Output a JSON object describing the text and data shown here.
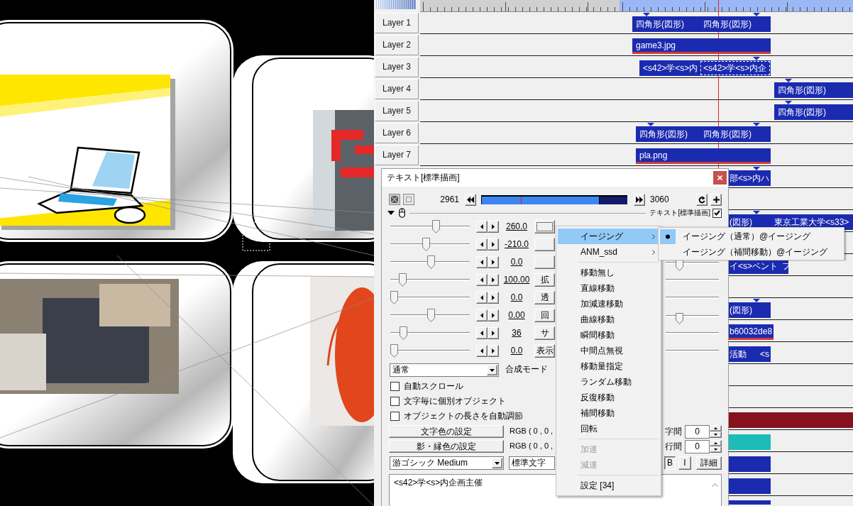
{
  "timeline": {
    "ruler": {
      "level": 0.54
    },
    "layers": [
      {
        "label": "Layer 1",
        "clips": [
          {
            "text": "四角形(図形)",
            "kind": "shape",
            "color": "#1b2bb0",
            "marker": true,
            "selected": false
          },
          {
            "text": "四角形(図形)",
            "kind": "shape",
            "color": "#1b2bb0",
            "marker": true,
            "selected": false
          }
        ]
      },
      {
        "label": "Layer 2",
        "clips": [
          {
            "text": "game3.jpg",
            "kind": "image",
            "color": "#1b2bb0",
            "marker": false,
            "selected": false
          }
        ]
      },
      {
        "label": "Layer 3",
        "clips": [
          {
            "text": "<s42>学<s>内",
            "kind": "text",
            "color": "#1b2bb0",
            "marker": false,
            "selected": false
          },
          {
            "text": "<s42>学<s>内企",
            "kind": "text",
            "color": "#1b2bb0",
            "marker": true,
            "selected": true
          }
        ]
      },
      {
        "label": "Layer 4",
        "clips": [
          {
            "text": "四角形(図形)",
            "kind": "shape",
            "color": "#1b2bb0",
            "marker": true,
            "selected": false
          }
        ]
      },
      {
        "label": "Layer 5",
        "clips": [
          {
            "text": "四角形(図形)",
            "kind": "shape",
            "color": "#1b2bb0",
            "marker": true,
            "selected": false
          }
        ]
      },
      {
        "label": "Layer 6",
        "clips": [
          {
            "text": "四角形(図形)",
            "kind": "shape",
            "color": "#1b2bb0",
            "marker": true,
            "selected": false
          },
          {
            "text": "四角形(図形)",
            "kind": "shape",
            "color": "#1b2bb0",
            "marker": true,
            "selected": false
          }
        ]
      },
      {
        "label": "Layer 7",
        "clips": [
          {
            "text": "pla.png",
            "kind": "image",
            "color": "#1b2bb0",
            "marker": false,
            "selected": false
          }
        ]
      },
      {
        "clips": [
          {
            "text": "部<s>内ハ",
            "kind": "text",
            "color": "#1b2bb0",
            "marker": true,
            "selected": false
          }
        ]
      },
      {
        "clips": [
          {
            "text": "(図形)",
            "kind": "shape",
            "color": "#1b2bb0",
            "marker": true,
            "selected": false
          },
          {
            "text": "東京工業大学<s33>",
            "kind": "text",
            "color": "#1b2bb0",
            "marker": false,
            "selected": false
          }
        ]
      },
      {
        "clips": [
          {
            "text": "イ<s>ベント",
            "kind": "text",
            "color": "#1b2bb0",
            "marker": false,
            "selected": false
          },
          {
            "text": "フ",
            "kind": "text",
            "color": "#1b2bb0",
            "marker": false,
            "selected": false
          }
        ]
      },
      {
        "clips": [
          {
            "text": "(図形)",
            "kind": "shape",
            "color": "#1b2bb0",
            "marker": true,
            "selected": false
          }
        ]
      },
      {
        "clips": [
          {
            "text": "b60032de8",
            "kind": "image",
            "color": "#1b2bb0",
            "marker": false,
            "selected": false
          }
        ]
      },
      {
        "clips": [
          {
            "text": "活動",
            "kind": "text",
            "color": "#1b2bb0",
            "marker": false,
            "selected": false
          },
          {
            "text": "<s",
            "kind": "text",
            "color": "#1b2bb0",
            "marker": false,
            "selected": false
          }
        ]
      },
      {
        "clips": [
          {
            "kind": "filter",
            "color": "#86121d",
            "marker": false,
            "selected": false
          }
        ]
      },
      {
        "clips": [
          {
            "kind": "filter",
            "color": "#1cbdb8",
            "marker": false,
            "selected": false
          }
        ]
      },
      {
        "clips": [
          {
            "kind": "shape",
            "color": "#1b2bb0",
            "marker": false,
            "selected": false
          }
        ]
      },
      {
        "clips": [
          {
            "kind": "shape",
            "color": "#1b2bb0",
            "marker": false,
            "selected": false
          }
        ]
      },
      {
        "clips": [
          {
            "kind": "shape",
            "color": "#1b2bb0",
            "marker": false,
            "selected": false
          }
        ]
      }
    ]
  },
  "dialog": {
    "title": "テキスト[標準描画]",
    "frame_start": "2961",
    "frame_end": "3060",
    "seek_bar": {
      "level": 0.81,
      "cursor": {
        "level": 0.27
      }
    },
    "header": {
      "label": "テキスト[標準描画]",
      "checked": true
    },
    "sliders": [
      {
        "value": "260.0",
        "level": 0.58,
        "focused": true
      },
      {
        "value": "-210.0",
        "level": 0.45,
        "focused": false
      },
      {
        "value": "0.0",
        "level": 0.51,
        "focused": false,
        "end_slider": {
          "level": 0.22
        }
      },
      {
        "value": "100.00",
        "level": 0.12,
        "label": "拡",
        "focused": false
      },
      {
        "value": "0.0",
        "level": 0,
        "label": "透",
        "focused": false
      },
      {
        "value": "0.00",
        "level": 0.51,
        "label": "回",
        "focused": false,
        "end_slider": {
          "level": 0.22
        }
      },
      {
        "value": "36",
        "level": 0.13,
        "label": "サ",
        "focused": false
      },
      {
        "value": "0.0",
        "level": 0,
        "label": "表示",
        "focused": false
      }
    ],
    "blend": {
      "value": "通常",
      "label": "合成モード"
    },
    "options": [
      {
        "label": "自動スクロール",
        "checked": false
      },
      {
        "label": "文字毎に個別オブジェクト",
        "checked": false
      },
      {
        "label": "オブジェクトの長さを自動調節",
        "checked": false
      }
    ],
    "color_settings": [
      {
        "button": "文字色の設定",
        "value": "RGB ( 0 , 0 ,"
      },
      {
        "button": "影・縁色の設定",
        "value": "RGB ( 0 , 0 ,"
      }
    ],
    "spacing": [
      {
        "label": "字間",
        "value": "0"
      },
      {
        "label": "行間",
        "value": "0"
      }
    ],
    "font": "游ゴシック Medium",
    "style": "標準文字",
    "format_buttons": [
      {
        "label": "B",
        "pressed": true
      },
      {
        "label": "I",
        "pressed": false
      },
      {
        "label": "詳細",
        "pressed": false
      }
    ],
    "text": "<s42>学<s>内企画主催"
  },
  "context_menu": {
    "groups": [
      {
        "items": [
          {
            "label": "イージング",
            "submenu": true,
            "selected": true,
            "disabled": false
          },
          {
            "label": "ANM_ssd",
            "submenu": true,
            "selected": false,
            "disabled": false
          }
        ]
      },
      {
        "items": [
          {
            "label": "移動無し",
            "submenu": false,
            "selected": false,
            "disabled": false
          },
          {
            "label": "直線移動",
            "submenu": false,
            "selected": false,
            "disabled": false
          },
          {
            "label": "加減速移動",
            "submenu": false,
            "selected": false,
            "disabled": false
          },
          {
            "label": "曲線移動",
            "submenu": false,
            "selected": false,
            "disabled": false
          },
          {
            "label": "瞬間移動",
            "submenu": false,
            "selected": false,
            "disabled": false
          },
          {
            "label": "中間点無視",
            "submenu": false,
            "selected": false,
            "disabled": false
          },
          {
            "label": "移動量指定",
            "submenu": false,
            "selected": false,
            "disabled": false
          },
          {
            "label": "ランダム移動",
            "submenu": false,
            "selected": false,
            "disabled": false
          },
          {
            "label": "反復移動",
            "submenu": false,
            "selected": false,
            "disabled": false
          },
          {
            "label": "補間移動",
            "submenu": false,
            "selected": false,
            "disabled": false
          },
          {
            "label": "回転",
            "submenu": false,
            "selected": false,
            "disabled": false
          }
        ]
      },
      {
        "items": [
          {
            "label": "加速",
            "submenu": false,
            "selected": false,
            "disabled": true
          },
          {
            "label": "減速",
            "submenu": false,
            "selected": false,
            "disabled": true
          }
        ]
      },
      {
        "items": [
          {
            "label": "設定 [34]",
            "submenu": false,
            "selected": false,
            "disabled": false
          }
        ]
      }
    ]
  },
  "submenu": {
    "items": [
      {
        "label": "イージング（通常）@イージング",
        "selected": true
      },
      {
        "label": "イージング（補間移動）@イージング",
        "selected": false
      }
    ]
  }
}
